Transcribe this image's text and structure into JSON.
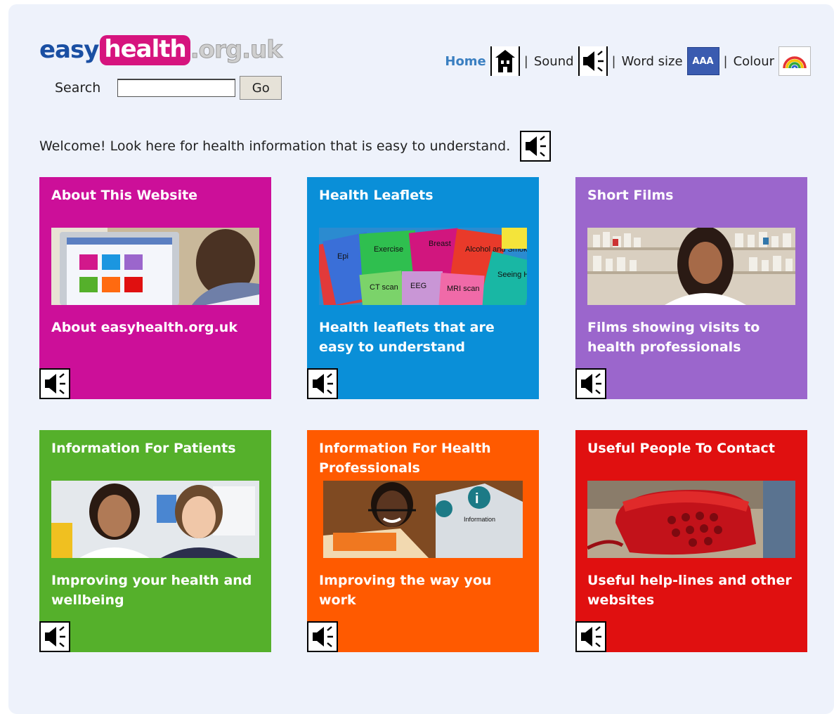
{
  "logo": {
    "part1": "easy",
    "part2": "health",
    "part3": ".org.uk"
  },
  "search": {
    "label": "Search",
    "value": "",
    "placeholder": "",
    "button": "Go"
  },
  "topnav": {
    "home": "Home",
    "sep": "|",
    "sound": "Sound",
    "word_size": "Word size",
    "aaa": "AAA",
    "colour": "Colour"
  },
  "welcome": "Welcome! Look here for health information that is easy to understand.",
  "tiles": [
    {
      "title": "About This Website",
      "desc": "About easyhealth.org.uk",
      "color": "#cc0f99"
    },
    {
      "title": "Health Leaflets",
      "desc": "Health leaflets that are easy to understand",
      "color": "#0a8fd8",
      "leaflets": [
        "Epi",
        "Exercise",
        "Breast",
        "Alcohol and Smok",
        "Seeing Hearin",
        "CT scan",
        "EEG",
        "MRI scan"
      ]
    },
    {
      "title": "Short Films",
      "desc": "Films showing visits to health professionals",
      "color": "#9b66cc"
    },
    {
      "title": "Information For Patients",
      "desc": "Improving your health and wellbeing",
      "color": "#55b02b"
    },
    {
      "title": "Information For Health Professionals",
      "desc": "Improving the way you work",
      "color": "#ff5a00",
      "sign": "Information"
    },
    {
      "title": "Useful People To Contact",
      "desc": "Useful help-lines and other websites",
      "color": "#e01010"
    }
  ]
}
